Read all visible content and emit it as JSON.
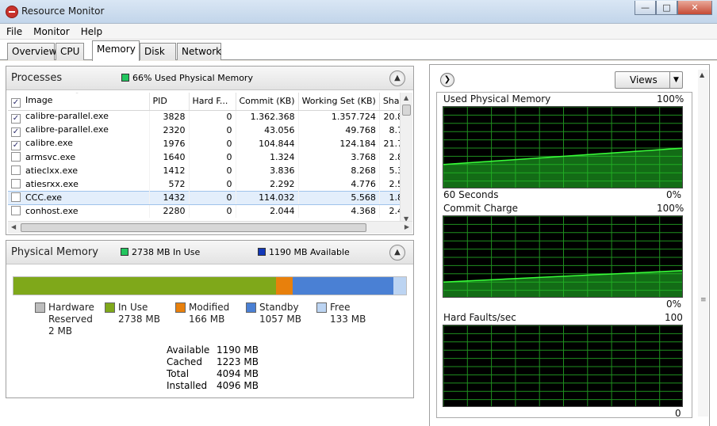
{
  "window": {
    "title": "Resource Monitor"
  },
  "menu": [
    "File",
    "Monitor",
    "Help"
  ],
  "tabs": [
    "Overview",
    "CPU",
    "Memory",
    "Disk",
    "Network"
  ],
  "processes": {
    "title": "Processes",
    "badge": "66% Used Physical Memory",
    "badge_color": "#22c55e",
    "columns": [
      "Image",
      "PID",
      "Hard F...",
      "Commit (KB)",
      "Working Set (KB)",
      "Shar"
    ],
    "rows": [
      {
        "checked": true,
        "image": "calibre-parallel.exe",
        "pid": "3828",
        "hard": "0",
        "commit": "1.362.368",
        "ws": "1.357.724",
        "share": "20.8"
      },
      {
        "checked": true,
        "image": "calibre-parallel.exe",
        "pid": "2320",
        "hard": "0",
        "commit": "43.056",
        "ws": "49.768",
        "share": "8.7"
      },
      {
        "checked": true,
        "image": "calibre.exe",
        "pid": "1976",
        "hard": "0",
        "commit": "104.844",
        "ws": "124.184",
        "share": "21.7"
      },
      {
        "checked": false,
        "image": "armsvc.exe",
        "pid": "1640",
        "hard": "0",
        "commit": "1.324",
        "ws": "3.768",
        "share": "2.8"
      },
      {
        "checked": false,
        "image": "atieclxx.exe",
        "pid": "1412",
        "hard": "0",
        "commit": "3.836",
        "ws": "8.268",
        "share": "5.3"
      },
      {
        "checked": false,
        "image": "atiesrxx.exe",
        "pid": "572",
        "hard": "0",
        "commit": "2.292",
        "ws": "4.776",
        "share": "2.5"
      },
      {
        "checked": false,
        "image": "CCC.exe",
        "pid": "1432",
        "hard": "0",
        "commit": "114.032",
        "ws": "5.568",
        "share": "1.8",
        "selected": true
      },
      {
        "checked": false,
        "image": "conhost.exe",
        "pid": "2280",
        "hard": "0",
        "commit": "2.044",
        "ws": "4.368",
        "share": "2.4"
      }
    ]
  },
  "physical": {
    "title": "Physical Memory",
    "in_use_badge": "2738 MB In Use",
    "available_badge": "1190 MB Available",
    "bar": [
      {
        "name": "hardware",
        "fraction": 0.0005,
        "color": "#9d9d9d"
      },
      {
        "name": "in-use",
        "fraction": 0.669,
        "color": "#7fa81a"
      },
      {
        "name": "modified",
        "fraction": 0.041,
        "color": "#e8800c"
      },
      {
        "name": "standby",
        "fraction": 0.258,
        "color": "#4a80d4"
      },
      {
        "name": "free",
        "fraction": 0.032,
        "color": "#bcd4f2"
      }
    ],
    "legend": {
      "hardware": {
        "label": "Hardware\nReserved",
        "value": "2 MB"
      },
      "in_use": {
        "label": "In Use",
        "value": "2738 MB"
      },
      "modified": {
        "label": "Modified",
        "value": "166 MB"
      },
      "standby": {
        "label": "Standby",
        "value": "1057 MB"
      },
      "free": {
        "label": "Free",
        "value": "133 MB"
      }
    },
    "stats": [
      {
        "k": "Available",
        "v": "1190 MB"
      },
      {
        "k": "Cached",
        "v": "1223 MB"
      },
      {
        "k": "Total",
        "v": "4094 MB"
      },
      {
        "k": "Installed",
        "v": "4096 MB"
      }
    ]
  },
  "graphs": {
    "views_label": "Views",
    "used_physical": {
      "title": "Used Physical Memory",
      "max": "100%",
      "min": "0%",
      "time": "60 Seconds",
      "start_level": 0.3,
      "end_level": 0.5
    },
    "commit_charge": {
      "title": "Commit Charge",
      "max": "100%",
      "min": "0%",
      "start_level": 0.2,
      "end_level": 0.34
    },
    "hard_faults": {
      "title": "Hard Faults/sec",
      "max": "100",
      "min": "0"
    }
  }
}
